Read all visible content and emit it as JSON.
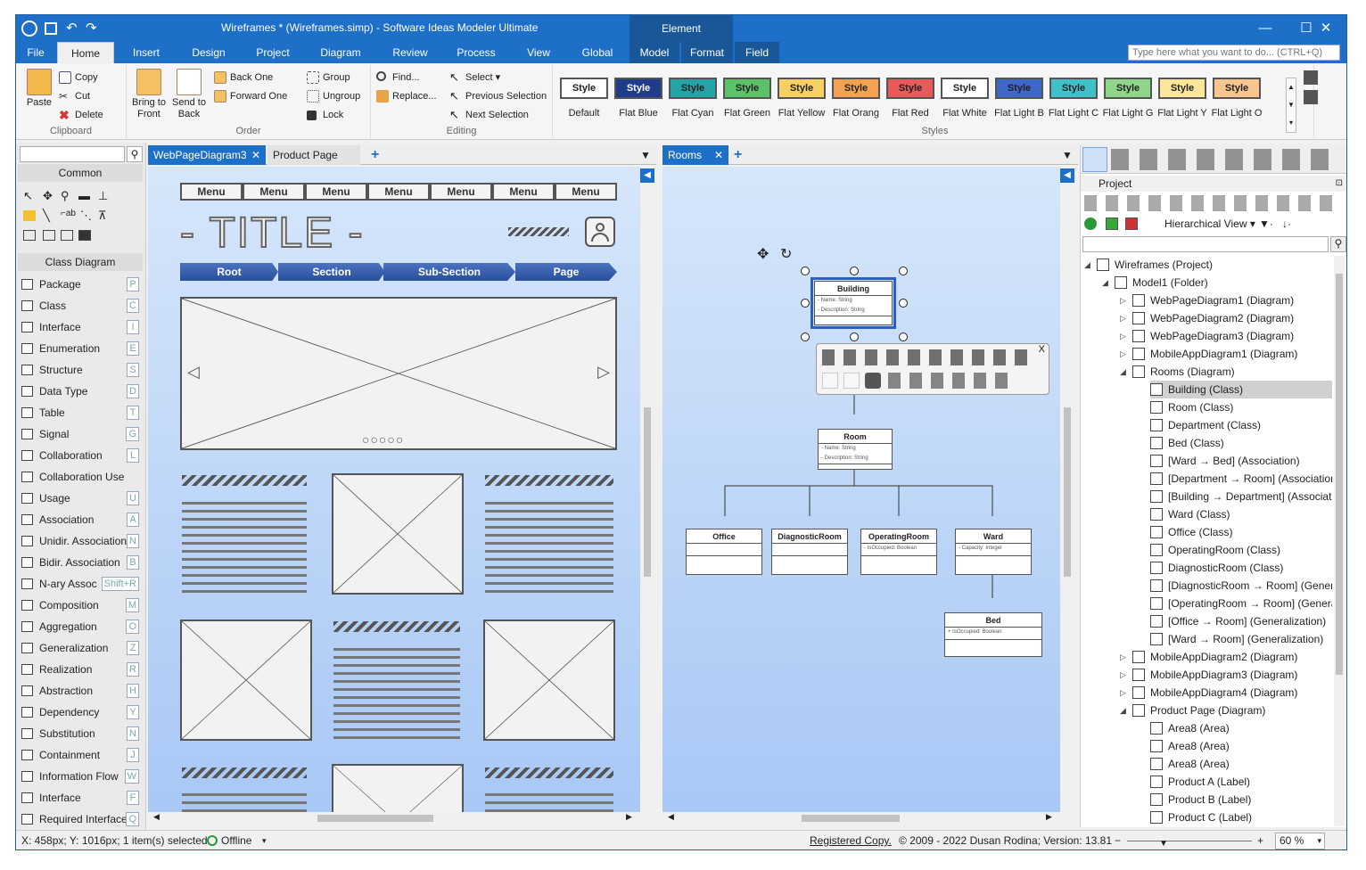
{
  "titlebar": {
    "title": "Wireframes * (Wireframes.simp) - Software Ideas Modeler Ultimate",
    "context": "Element"
  },
  "tabs": [
    "File",
    "Home",
    "Insert",
    "Design",
    "Project",
    "Diagram",
    "Review",
    "Process",
    "View",
    "Global",
    "Model",
    "Format",
    "Field"
  ],
  "search": {
    "placeholder": "Type here what you want to do... (CTRL+Q)"
  },
  "clipboard": {
    "paste": "Paste",
    "copy": "Copy",
    "cut": "Cut",
    "delete": "Delete",
    "label": "Clipboard"
  },
  "order": {
    "bring": "Bring to Front",
    "send": "Send to Back",
    "back_one": "Back One",
    "forward_one": "Forward One",
    "group": "Group",
    "ungroup": "Ungroup",
    "lock": "Lock",
    "label": "Order"
  },
  "editing": {
    "find": "Find...",
    "replace": "Replace...",
    "select": "Select",
    "prev": "Previous Selection",
    "next": "Next Selection",
    "label": "Editing"
  },
  "styles": {
    "label": "Styles",
    "button_text": "Style",
    "names": [
      "Default",
      "Flat Blue",
      "Flat Cyan",
      "Flat Green",
      "Flat Yellow",
      "Flat Orang",
      "Flat Red",
      "Flat White",
      "Flat Light B",
      "Flat Light C",
      "Flat Light G",
      "Flat Light Y",
      "Flat Light O"
    ],
    "fills": [
      "#ffffff",
      "#1f3c8a",
      "#24a3a8",
      "#5cc268",
      "#f7cf63",
      "#f5a152",
      "#e85a5a",
      "#ffffff",
      "#3d68c7",
      "#3fc1c9",
      "#8fd68a",
      "#fbe69a",
      "#f8c58f"
    ],
    "text_colors": [
      "#222",
      "#fff",
      "#222",
      "#222",
      "#222",
      "#222",
      "#222",
      "#222",
      "#222",
      "#222",
      "#222",
      "#222",
      "#222"
    ]
  },
  "left_panel": {
    "common": "Common",
    "class_diagram": "Class Diagram",
    "items": [
      {
        "label": "Package",
        "key": "P"
      },
      {
        "label": "Class",
        "key": "C"
      },
      {
        "label": "Interface",
        "key": "I"
      },
      {
        "label": "Enumeration",
        "key": "E"
      },
      {
        "label": "Structure",
        "key": "S"
      },
      {
        "label": "Data Type",
        "key": "D"
      },
      {
        "label": "Table",
        "key": "T"
      },
      {
        "label": "Signal",
        "key": "G"
      },
      {
        "label": "Collaboration",
        "key": "L"
      },
      {
        "label": "Collaboration Use",
        "key": ""
      },
      {
        "label": "Usage",
        "key": "U"
      },
      {
        "label": "Association",
        "key": "A"
      },
      {
        "label": "Unidir. Association",
        "key": "N"
      },
      {
        "label": "Bidir. Association",
        "key": "B"
      },
      {
        "label": "N-ary Assoc",
        "key": "Shift+R"
      },
      {
        "label": "Composition",
        "key": "M"
      },
      {
        "label": "Aggregation",
        "key": "O"
      },
      {
        "label": "Generalization",
        "key": "Z"
      },
      {
        "label": "Realization",
        "key": "R"
      },
      {
        "label": "Abstraction",
        "key": "H"
      },
      {
        "label": "Dependency",
        "key": "Y"
      },
      {
        "label": "Substitution",
        "key": "N"
      },
      {
        "label": "Containment",
        "key": "J"
      },
      {
        "label": "Information Flow",
        "key": "W"
      },
      {
        "label": "Interface",
        "key": "F"
      },
      {
        "label": "Required Interface",
        "key": "Q"
      }
    ]
  },
  "doc_tabs_left": [
    "WebPageDiagram3",
    "Product Page"
  ],
  "doc_tabs_right": [
    "Rooms"
  ],
  "wireframe": {
    "menus": [
      "Menu",
      "Menu",
      "Menu",
      "Menu",
      "Menu",
      "Menu",
      "Menu"
    ],
    "title": "- TITLE -",
    "crumbs": [
      "Root",
      "Section",
      "Sub-Section",
      "Page"
    ]
  },
  "uml": {
    "building": {
      "name": "Building",
      "attrs": [
        "- Name: String",
        "- Description: String"
      ]
    },
    "room": {
      "name": "Room",
      "attrs": [
        "- Name: String",
        "- Description: String"
      ]
    },
    "office": {
      "name": "Office",
      "attrs": []
    },
    "diagnostic": {
      "name": "DiagnosticRoom",
      "attrs": []
    },
    "operating": {
      "name": "OperatingRoom",
      "attrs": [
        "- IsOccupied: Boolean"
      ]
    },
    "ward": {
      "name": "Ward",
      "attrs": [
        "- Capacity: Integer"
      ]
    },
    "bed": {
      "name": "Bed",
      "attrs": [
        "+ IsOccupied: Boolean"
      ]
    }
  },
  "project": {
    "title": "Project",
    "view": "Hierarchical View",
    "tree": [
      {
        "label": "Wireframes (Project)",
        "lvl": 0,
        "exp": "open"
      },
      {
        "label": "Model1 (Folder)",
        "lvl": 1,
        "exp": "open"
      },
      {
        "label": "WebPageDiagram1 (Diagram)",
        "lvl": 2,
        "exp": "closed"
      },
      {
        "label": "WebPageDiagram2 (Diagram)",
        "lvl": 2,
        "exp": "closed"
      },
      {
        "label": "WebPageDiagram3 (Diagram)",
        "lvl": 2,
        "exp": "closed"
      },
      {
        "label": "MobileAppDiagram1 (Diagram)",
        "lvl": 2,
        "exp": "closed"
      },
      {
        "label": "Rooms (Diagram)",
        "lvl": 2,
        "exp": "open"
      },
      {
        "label": "Building (Class)",
        "lvl": 3,
        "exp": "",
        "sel": true
      },
      {
        "label": "Room (Class)",
        "lvl": 3,
        "exp": ""
      },
      {
        "label": "Department (Class)",
        "lvl": 3,
        "exp": ""
      },
      {
        "label": "Bed (Class)",
        "lvl": 3,
        "exp": ""
      },
      {
        "label": "[Ward → Bed] (Association)",
        "lvl": 3,
        "exp": ""
      },
      {
        "label": "[Department → Room] (Association)",
        "lvl": 3,
        "exp": ""
      },
      {
        "label": "[Building → Department] (Associatio",
        "lvl": 3,
        "exp": ""
      },
      {
        "label": "Ward (Class)",
        "lvl": 3,
        "exp": ""
      },
      {
        "label": "Office (Class)",
        "lvl": 3,
        "exp": ""
      },
      {
        "label": "OperatingRoom (Class)",
        "lvl": 3,
        "exp": ""
      },
      {
        "label": "DiagnosticRoom (Class)",
        "lvl": 3,
        "exp": ""
      },
      {
        "label": "[DiagnosticRoom → Room] (General",
        "lvl": 3,
        "exp": ""
      },
      {
        "label": "[OperatingRoom → Room] (Generali",
        "lvl": 3,
        "exp": ""
      },
      {
        "label": "[Office → Room] (Generalization)",
        "lvl": 3,
        "exp": ""
      },
      {
        "label": "[Ward → Room] (Generalization)",
        "lvl": 3,
        "exp": ""
      },
      {
        "label": "MobileAppDiagram2 (Diagram)",
        "lvl": 2,
        "exp": "closed"
      },
      {
        "label": "MobileAppDiagram3 (Diagram)",
        "lvl": 2,
        "exp": "closed"
      },
      {
        "label": "MobileAppDiagram4 (Diagram)",
        "lvl": 2,
        "exp": "closed"
      },
      {
        "label": "Product Page (Diagram)",
        "lvl": 2,
        "exp": "open"
      },
      {
        "label": "Area8 (Area)",
        "lvl": 3,
        "exp": ""
      },
      {
        "label": "Area8 (Area)",
        "lvl": 3,
        "exp": ""
      },
      {
        "label": "Area8 (Area)",
        "lvl": 3,
        "exp": ""
      },
      {
        "label": "Product A (Label)",
        "lvl": 3,
        "exp": ""
      },
      {
        "label": "Product B (Label)",
        "lvl": 3,
        "exp": ""
      },
      {
        "label": "Product C (Label)",
        "lvl": 3,
        "exp": ""
      }
    ]
  },
  "status": {
    "coords": "X: 458px; Y: 1016px; 1 item(s) selected",
    "offline": "Offline",
    "registered": "Registered Copy.",
    "copyright": "© 2009 - 2022 Dusan Rodina; Version: 13.81",
    "zoom": "60 %"
  }
}
